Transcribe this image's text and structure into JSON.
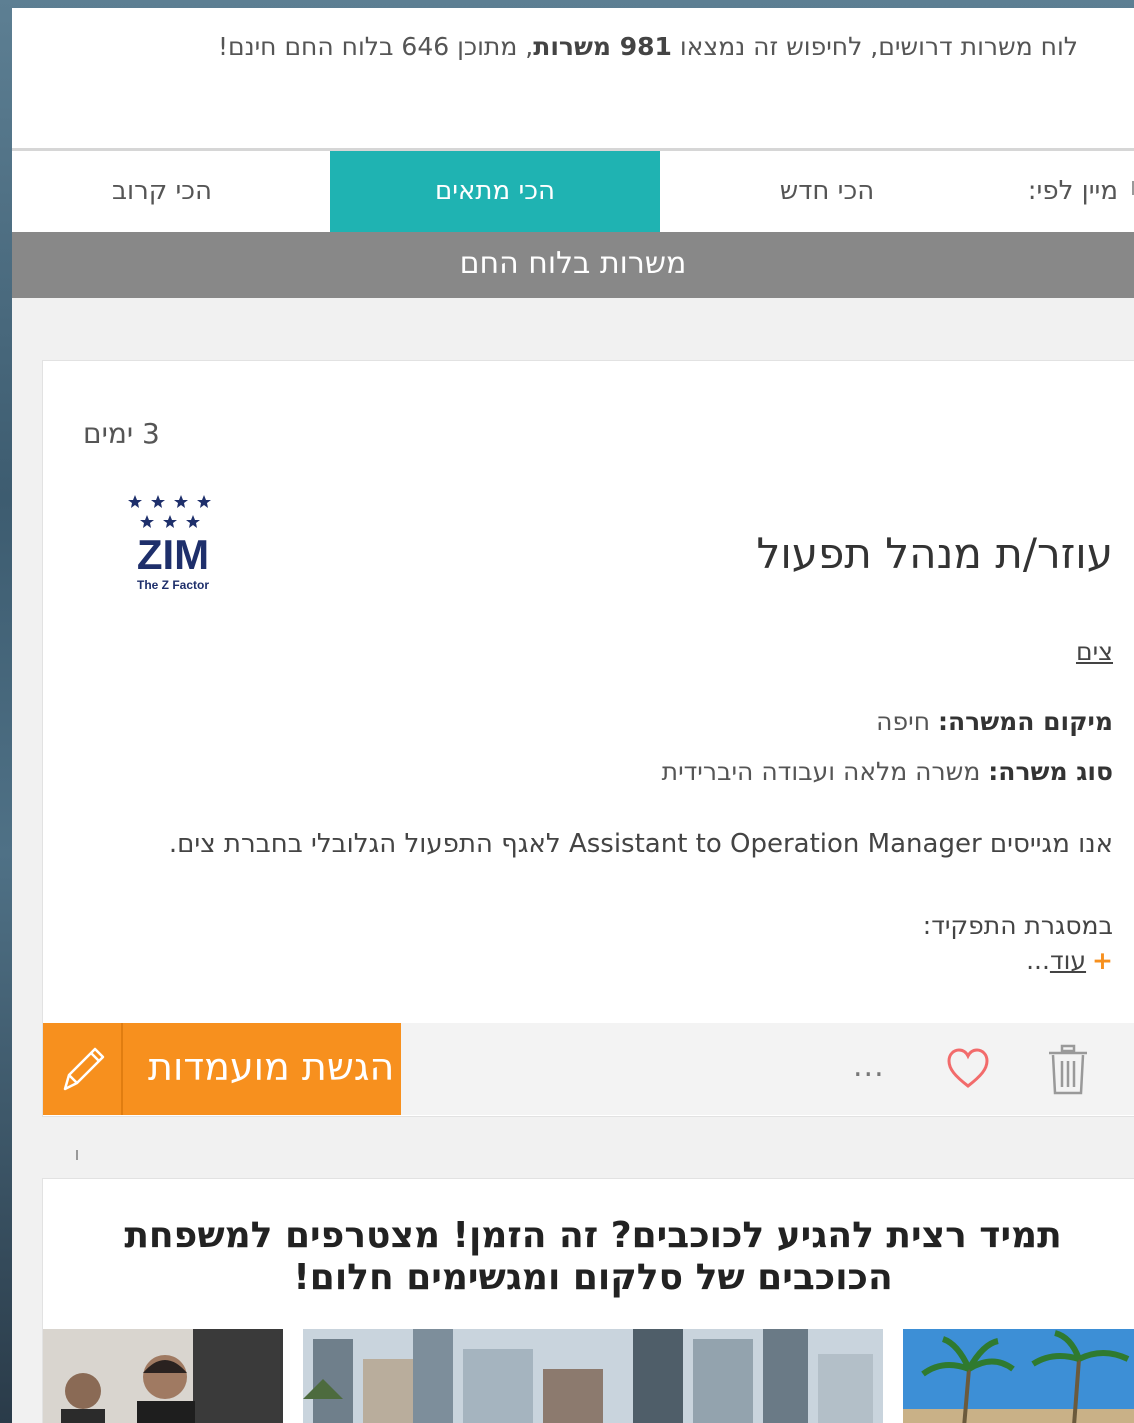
{
  "summary": {
    "prefix": "לוח משרות דרושים, לחיפוש זה נמצאו ",
    "count": "981 משרות",
    "suffix": ", מתוכן 646 בלוח החם חינם!"
  },
  "sort": {
    "label": "מיין לפי:",
    "options": [
      "הכי חדש",
      "הכי מתאים",
      "הכי קרוב"
    ],
    "active": "הכי מתאים"
  },
  "section_title": "משרות בלוח החם",
  "job": {
    "days": "3 ימים",
    "title": "עוזר/ת מנהל תפעול",
    "company": "צים",
    "location_label": "מיקום המשרה:",
    "location_value": "חיפה",
    "type_label": "סוג משרה:",
    "type_value": "משרה מלאה ועבודה היברידית",
    "description": "אנו מגייסים Assistant to Operation Manager לאגף התפעול הגלובלי בחברת צים.",
    "role_heading": "במסגרת התפקיד:",
    "more_plus": "+",
    "more_label": "עוד",
    "more_suffix": "...",
    "logo": {
      "brand": "ZIM",
      "tagline": "The Z Factor",
      "color": "#1e2f6b"
    }
  },
  "actions": {
    "apply_label": "הגשת מועמדות",
    "apply_icon": "pencil-icon",
    "more_icon": "ellipsis-icon",
    "more_dots": "...",
    "favorite_icon": "heart-icon",
    "delete_icon": "trash-icon",
    "apply_color": "#f7901e"
  },
  "promo": {
    "title": "תמיד רצית להגיע לכוכבים? זה הזמן! מצטרפים למשפחת הכוכבים של סלקום ומגשימים חלום!"
  },
  "colors": {
    "accent": "#1fb3b2",
    "band": "#888888",
    "apply": "#f7901e"
  }
}
